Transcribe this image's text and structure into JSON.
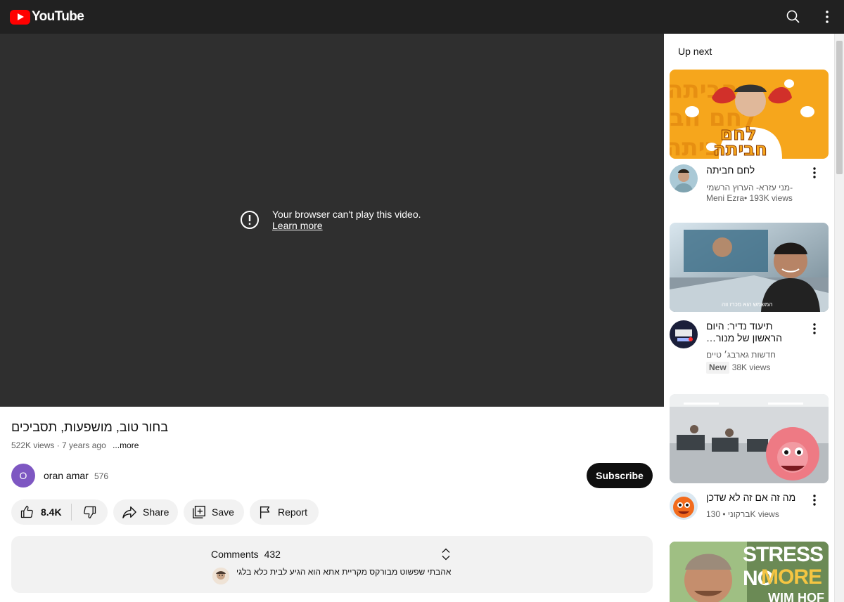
{
  "header": {
    "logo_text": "YouTube",
    "search_icon": "search-icon",
    "menu_icon": "more-vert-icon"
  },
  "player": {
    "message": "Your browser can't play this video.",
    "link": "Learn more",
    "icon": "alert-circle-icon"
  },
  "video": {
    "title": "בחור טוב, מושפעות, תסביכים",
    "views_line": "522K views · 7 years ago",
    "more": "...more"
  },
  "channel": {
    "avatar_letter": "O",
    "name": "oran amar",
    "subscribers": "576",
    "subscribe_label": "Subscribe"
  },
  "actions": {
    "likes": "8.4K",
    "share": "Share",
    "save": "Save",
    "report": "Report"
  },
  "comments": {
    "label": "Comments",
    "count": "432",
    "top_comment": "אהבתי שפשוט מבורקס מקריית אתא הוא הגיע לבית כלא בלגי"
  },
  "sidebar": {
    "heading": "Up next",
    "items": [
      {
        "title": "לחם חביתה",
        "channel": "מני עזרא- הערוץ הרשמי-",
        "meta": "Meni Ezra• 193K views"
      },
      {
        "title": "תיעוד נדיר: היום הראשון של מנור…",
        "channel": "חדשות גארבג׳ טיים",
        "badge": "New",
        "views": "38K views",
        "thumb_caption": "המשמש הוא מכרז ווה"
      },
      {
        "title": "מה זה אם זה לא שדכן",
        "channel": "ברקוני",
        "views": "130K views"
      },
      {
        "thumb_text_1": "STRESS NO",
        "thumb_text_2": "MORE",
        "thumb_text_3": "WIM HOF"
      }
    ]
  },
  "colors": {
    "header_bg": "#212121",
    "player_bg": "#2f2f2f",
    "brand_red": "#ff0000",
    "pill_bg": "#f2f2f2",
    "subscribe_bg": "#0f0f0f",
    "channel_avatar": "#7e57c2"
  }
}
